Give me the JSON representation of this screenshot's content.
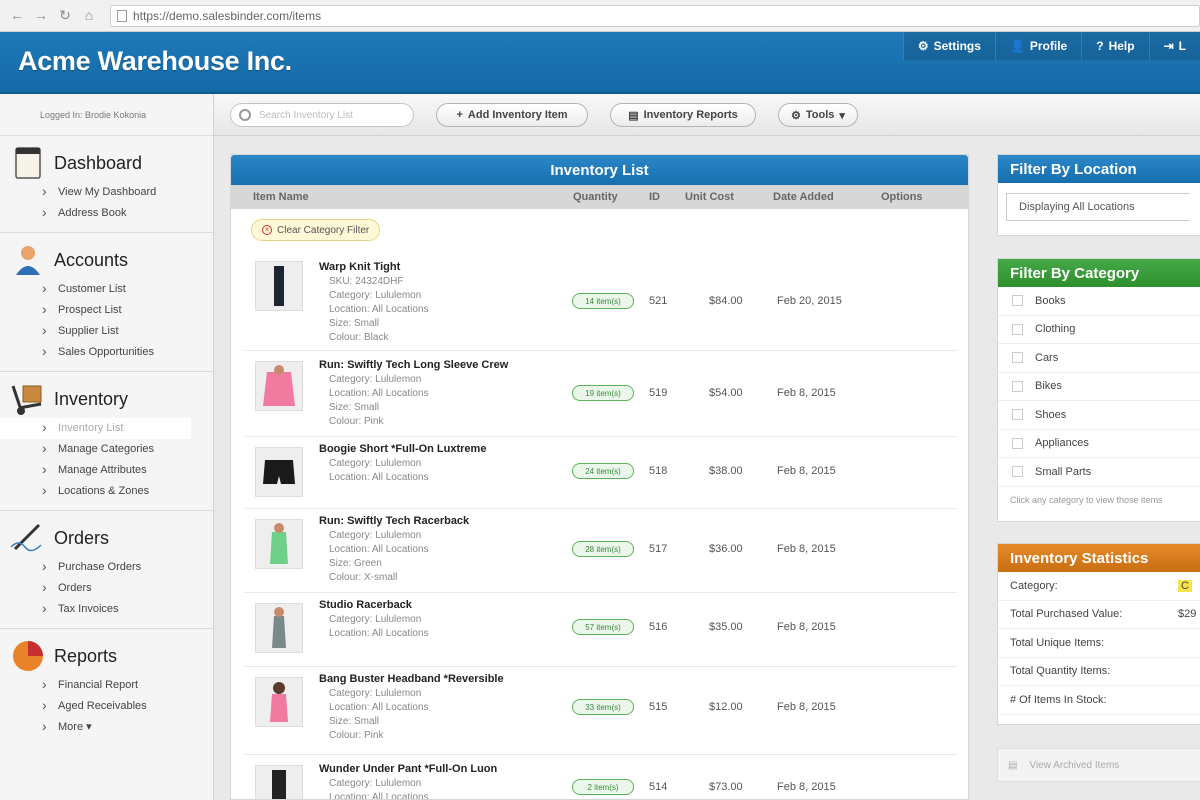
{
  "browser": {
    "url": "https://demo.salesbinder.com/items"
  },
  "header": {
    "brand": "Acme Warehouse Inc.",
    "nav": [
      {
        "label": "Settings",
        "icon": "gear-icon"
      },
      {
        "label": "Profile",
        "icon": "user-icon"
      },
      {
        "label": "Help",
        "icon": "help-icon"
      },
      {
        "label": "L",
        "icon": "logout-icon"
      }
    ]
  },
  "sidebar": {
    "logged_in": "Logged In: Brodie Kokonia",
    "sections": [
      {
        "title": "Dashboard",
        "items": [
          "View My Dashboard",
          "Address Book"
        ]
      },
      {
        "title": "Accounts",
        "items": [
          "Customer List",
          "Prospect List",
          "Supplier List",
          "Sales Opportunities"
        ]
      },
      {
        "title": "Inventory",
        "items": [
          "Inventory List",
          "Manage Categories",
          "Manage Attributes",
          "Locations & Zones"
        ]
      },
      {
        "title": "Orders",
        "items": [
          "Purchase Orders",
          "Orders",
          "Tax Invoices"
        ]
      },
      {
        "title": "Reports",
        "items": [
          "Financial Report",
          "Aged Receivables",
          "More ▾"
        ]
      }
    ]
  },
  "toolbar": {
    "search_placeholder": "Search Inventory List",
    "add_label": "Add Inventory Item",
    "reports_label": "Inventory Reports",
    "tools_label": "Tools"
  },
  "inventory": {
    "title": "Inventory List",
    "columns": {
      "name": "Item Name",
      "quantity": "Quantity",
      "id": "ID",
      "cost": "Unit Cost",
      "date": "Date Added",
      "options": "Options"
    },
    "clear_filter": "Clear Category Filter",
    "rows": [
      {
        "name": "Warp Knit Tight",
        "meta": [
          "SKU: 24324DHF",
          "Category: Lululemon",
          "Location: All Locations",
          "Size: Small",
          "Colour: Black"
        ],
        "qty": "14 item(s)",
        "id": "521",
        "cost": "$84.00",
        "date": "Feb 20, 2015"
      },
      {
        "name": "Run: Swiftly Tech Long Sleeve Crew",
        "meta": [
          "Category: Lululemon",
          "Location: All Locations",
          "Size: Small",
          "Colour: Pink"
        ],
        "qty": "19 item(s)",
        "id": "519",
        "cost": "$54.00",
        "date": "Feb 8, 2015"
      },
      {
        "name": "Boogie Short *Full-On Luxtreme",
        "meta": [
          "Category: Lululemon",
          "Location: All Locations"
        ],
        "qty": "24 item(s)",
        "id": "518",
        "cost": "$38.00",
        "date": "Feb 8, 2015"
      },
      {
        "name": "Run: Swiftly Tech Racerback",
        "meta": [
          "Category: Lululemon",
          "Location: All Locations",
          "Size: Green",
          "Colour: X-small"
        ],
        "qty": "28 item(s)",
        "id": "517",
        "cost": "$36.00",
        "date": "Feb 8, 2015"
      },
      {
        "name": "Studio Racerback",
        "meta": [
          "Category: Lululemon",
          "Location: All Locations"
        ],
        "qty": "57 item(s)",
        "id": "516",
        "cost": "$35.00",
        "date": "Feb 8, 2015"
      },
      {
        "name": "Bang Buster Headband *Reversible",
        "meta": [
          "Category: Lululemon",
          "Location: All Locations",
          "Size: Small",
          "Colour: Pink"
        ],
        "qty": "33 item(s)",
        "id": "515",
        "cost": "$12.00",
        "date": "Feb 8, 2015"
      },
      {
        "name": "Wunder Under Pant *Full-On Luon",
        "meta": [
          "Category: Lululemon",
          "Location: All Locations"
        ],
        "qty": "2 item(s)",
        "id": "514",
        "cost": "$73.00",
        "date": "Feb 8, 2015"
      }
    ]
  },
  "location_filter": {
    "title": "Filter By Location",
    "value": "Displaying All Locations"
  },
  "category_filter": {
    "title": "Filter By Category",
    "items": [
      "Books",
      "Clothing",
      "Cars",
      "Bikes",
      "Shoes",
      "Appliances",
      "Small Parts"
    ],
    "hint": "Click any category to view those items"
  },
  "stats": {
    "title": "Inventory Statistics",
    "rows": [
      {
        "label": "Category:",
        "value": "C"
      },
      {
        "label": "Total Purchased Value:",
        "value": "$29"
      },
      {
        "label": "Total Unique Items:",
        "value": ""
      },
      {
        "label": "Total Quantity Items:",
        "value": ""
      },
      {
        "label": "# Of Items In Stock:",
        "value": ""
      }
    ]
  },
  "archived_label": "View Archived Items",
  "colors": {
    "header_blue": "#1f79b8",
    "green": "#3a9a3a",
    "orange": "#d97c1c"
  }
}
